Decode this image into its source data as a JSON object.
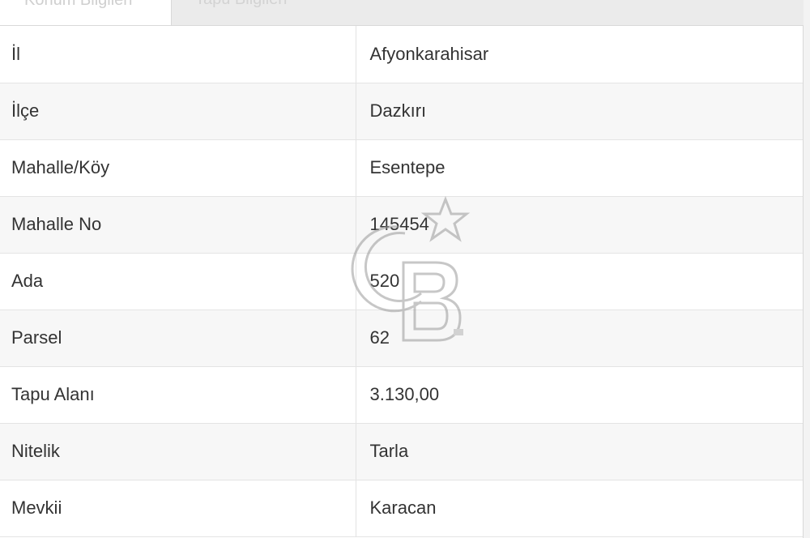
{
  "tabs": [
    {
      "label": "Konum Bilgileri"
    },
    {
      "label": "Tapu Bilgileri"
    }
  ],
  "rows": [
    {
      "label": "İl",
      "value": "Afyonkarahisar"
    },
    {
      "label": "İlçe",
      "value": "Dazkırı"
    },
    {
      "label": "Mahalle/Köy",
      "value": "Esentepe"
    },
    {
      "label": "Mahalle No",
      "value": "145454"
    },
    {
      "label": "Ada",
      "value": "520"
    },
    {
      "label": "Parsel",
      "value": "62"
    },
    {
      "label": "Tapu Alanı",
      "value": "3.130,00"
    },
    {
      "label": "Nitelik",
      "value": "Tarla"
    },
    {
      "label": "Mevkii",
      "value": "Karacan"
    }
  ],
  "watermark": {
    "logo": "CB",
    "icon": "star-icon"
  },
  "colors": {
    "border": "#d9d9d9",
    "text": "#333333",
    "zebra": "#f7f7f7"
  }
}
